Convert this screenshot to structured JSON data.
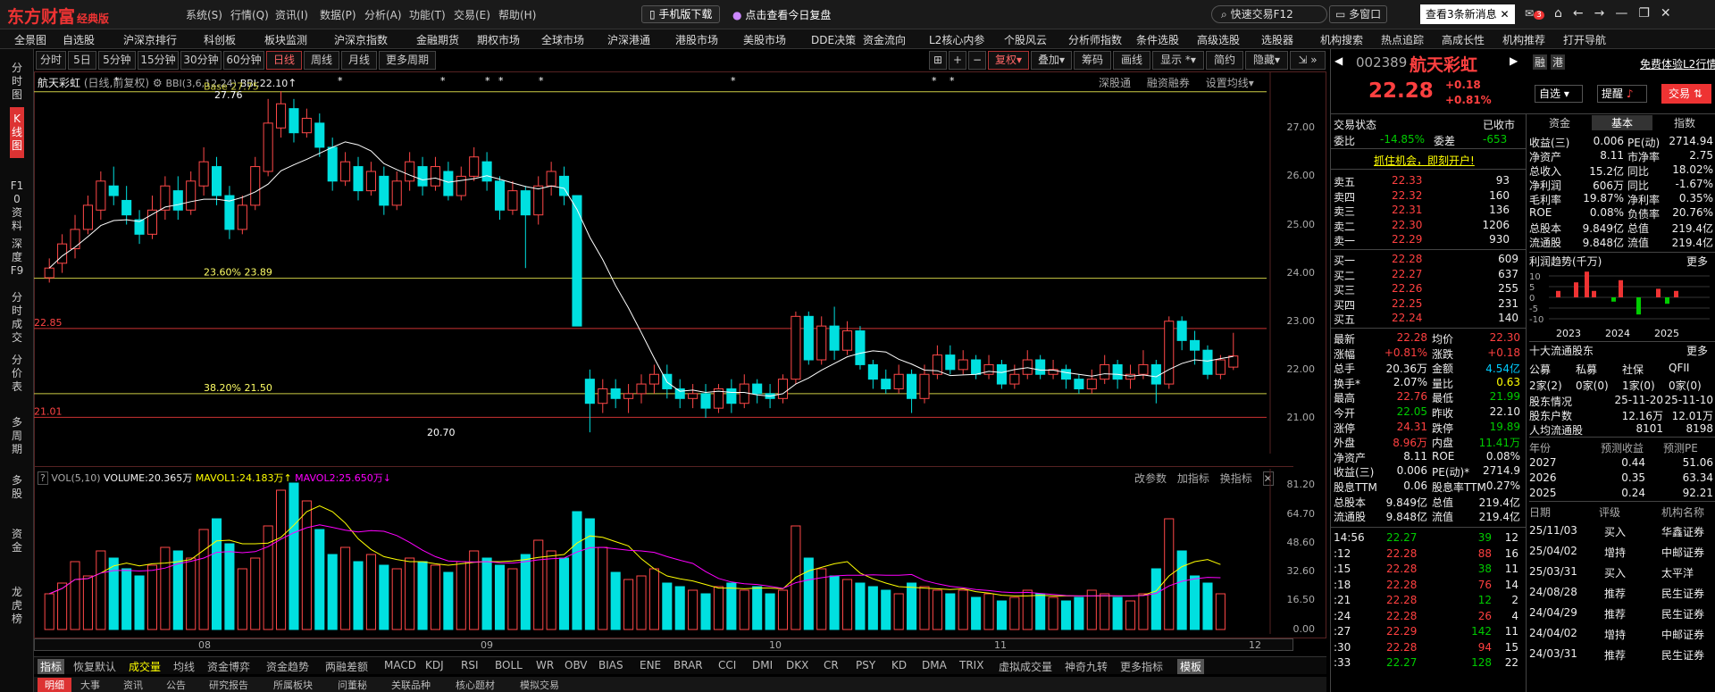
{
  "app": {
    "logo": "东方财富",
    "edition": "经典版",
    "menus": [
      "系统(S)",
      "行情(Q)",
      "资讯(I)",
      "数据(P)",
      "分析(A)",
      "功能(T)",
      "交易(E)",
      "帮助(H)"
    ],
    "mobile": "手机版下载",
    "review": "点击查看今日复盘",
    "quick_trade": "快速交易F12",
    "multi_window": "多窗口",
    "news": "查看3条新消息",
    "badge": "3"
  },
  "menubar": [
    "全景图",
    "自选股",
    "沪深京排行",
    "科创板",
    "板块监测",
    "沪深京指数",
    "金融期货",
    "期权市场",
    "全球市场",
    "沪深港通",
    "港股市场",
    "美股市场",
    "DDE决策",
    "资金流向",
    "L2核心内参",
    "个股风云",
    "分析师指数",
    "条件选股",
    "高级选股",
    "选股器",
    "机构搜索",
    "热点追踪",
    "高成长性",
    "机构推荐",
    "打开导航"
  ],
  "leftnav": [
    "分时图",
    "K线图",
    "F10资料",
    "深度F9",
    "分时成交",
    "分价表",
    "多周期",
    "多股",
    "资金",
    "龙虎榜"
  ],
  "periods": [
    "分时",
    "5日",
    "5分钟",
    "15分钟",
    "30分钟",
    "60分钟",
    "日线",
    "周线",
    "月线",
    "更多周期"
  ],
  "toolbar": [
    "复权",
    "叠加",
    "筹码",
    "画线",
    "显示",
    "简约",
    "隐藏"
  ],
  "kline": {
    "title": "航天彩虹",
    "subtitle": "(日线,前复权)",
    "bbi": "BBI(3,6,12,24)",
    "bbi_val": "BBI:22.10",
    "links": [
      "深股通",
      "融资融券",
      "设置均线"
    ],
    "y_labels": [
      "27.00",
      "26.00",
      "25.00",
      "24.00",
      "23.00",
      "22.00",
      "21.00"
    ],
    "fib": [
      "23.60% 23.89",
      "38.20% 21.50"
    ],
    "high_label": "27.76",
    "low_label": "20.70",
    "left_hi": "22.85",
    "left_lo": "21.01",
    "top_label": "Base 27.75"
  },
  "vol": {
    "title": "VOL(5,10)",
    "volume": "VOLUME:20.365万",
    "ma1": "MAVOL1:24.183万",
    "ma2": "MAVOL2:25.650万",
    "links": [
      "改参数",
      "加指标",
      "换指标"
    ],
    "y_labels": [
      "81.20",
      "64.70",
      "48.60",
      "32.60",
      "16.50",
      "0.00"
    ]
  },
  "x_axis": [
    "08",
    "09",
    "10",
    "11",
    "12"
  ],
  "indicators": [
    "指标",
    "恢复默认",
    "成交量",
    "均线",
    "资金博弈",
    "资金趋势",
    "两融差额",
    "MACD",
    "KDJ",
    "RSI",
    "BOLL",
    "WR",
    "OBV",
    "BIAS",
    "ENE",
    "BRAR",
    "CCI",
    "DMI",
    "DKX",
    "CR",
    "PSY",
    "KD",
    "DMA",
    "TRIX",
    "虚拟成交量",
    "神奇九转",
    "更多指标",
    "模板"
  ],
  "bottom_tabs": [
    "明细",
    "大事",
    "资讯",
    "公告",
    "研究报告",
    "所属板块",
    "问董秘",
    "关联品种",
    "核心题材",
    "模拟交易"
  ],
  "stock": {
    "code": "002389",
    "name": "航天彩虹",
    "price": "22.28",
    "chg": "+0.18",
    "pct": "+0.81%",
    "tags": [
      "融",
      "港"
    ],
    "l2": "免费体验L2行情",
    "select": "自选",
    "alert": "提醒",
    "trade": "交易"
  },
  "status": {
    "label": "交易状态",
    "value": "已收市",
    "wb_label": "委比",
    "wb": "-14.85%",
    "wc_label": "委差",
    "wc": "-653",
    "promo": "抓住机会，即刻开户!"
  },
  "sells": [
    [
      "卖五",
      "22.33",
      "93"
    ],
    [
      "卖四",
      "22.32",
      "160"
    ],
    [
      "卖三",
      "22.31",
      "136"
    ],
    [
      "卖二",
      "22.30",
      "1206"
    ],
    [
      "卖一",
      "22.29",
      "930"
    ]
  ],
  "buys": [
    [
      "买一",
      "22.28",
      "609"
    ],
    [
      "买二",
      "22.27",
      "637"
    ],
    [
      "买三",
      "22.26",
      "255"
    ],
    [
      "买四",
      "22.25",
      "231"
    ],
    [
      "买五",
      "22.24",
      "140"
    ]
  ],
  "quote": [
    [
      "最新",
      "22.28",
      "均价",
      "22.30"
    ],
    [
      "涨幅",
      "+0.81%",
      "涨跌",
      "+0.18"
    ],
    [
      "总手",
      "20.36万",
      "金额",
      "4.54亿"
    ],
    [
      "换手*",
      "2.07%",
      "量比",
      "0.63"
    ],
    [
      "最高",
      "22.76",
      "最低",
      "21.99"
    ],
    [
      "今开",
      "22.05",
      "昨收",
      "22.10"
    ],
    [
      "涨停",
      "24.31",
      "跌停",
      "19.89"
    ],
    [
      "外盘",
      "8.96万",
      "内盘",
      "11.41万"
    ],
    [
      "净资产",
      "8.11",
      "ROE",
      "0.08%"
    ],
    [
      "收益(三)",
      "0.006",
      "PE(动)*",
      "2714.9"
    ],
    [
      "股息TTM",
      "0.06",
      "股息率TTM",
      "0.27%"
    ],
    [
      "总股本",
      "9.849亿",
      "总值",
      "219.4亿"
    ],
    [
      "流通股",
      "9.848亿",
      "流值",
      "219.4亿"
    ]
  ],
  "ticks": [
    [
      "14:56",
      "22.27",
      "39",
      "12"
    ],
    [
      ":12",
      "22.28",
      "88",
      "16"
    ],
    [
      ":15",
      "22.28",
      "38",
      "11"
    ],
    [
      ":18",
      "22.28",
      "76",
      "14"
    ],
    [
      ":21",
      "22.28",
      "12",
      "2"
    ],
    [
      ":24",
      "22.28",
      "26",
      "4"
    ],
    [
      ":27",
      "22.29",
      "142",
      "11"
    ],
    [
      ":30",
      "22.28",
      "94",
      "15"
    ],
    [
      ":33",
      "22.27",
      "128",
      "22"
    ]
  ],
  "fin_tabs": [
    "资金",
    "基本",
    "指数"
  ],
  "fin": [
    [
      "收益(三)",
      "0.006",
      "PE(动)",
      "2714.94"
    ],
    [
      "净资产",
      "8.11",
      "市净率",
      "2.75"
    ],
    [
      "总收入",
      "15.2亿",
      "同比",
      "18.02%"
    ],
    [
      "净利润",
      "606万",
      "同比",
      "-1.67%"
    ],
    [
      "毛利率",
      "19.87%",
      "净利率",
      "0.35%"
    ],
    [
      "ROE",
      "0.08%",
      "负债率",
      "20.76%"
    ],
    [
      "总股本",
      "9.849亿",
      "总值",
      "219.4亿"
    ],
    [
      "流通股",
      "9.848亿",
      "流值",
      "219.4亿"
    ]
  ],
  "profit": {
    "title": "利润趋势(千万)",
    "more": "更多",
    "years": [
      "2023",
      "2024",
      "2025"
    ],
    "y": [
      "10",
      "5",
      "0",
      "-5",
      "-10"
    ]
  },
  "holders": {
    "title": "十大流通股东",
    "more": "更多",
    "cols": [
      "公募",
      "私募",
      "社保",
      "QFII"
    ],
    "vals": [
      "2家(2)",
      "0家(0)",
      "1家(0)",
      "0家(0)"
    ],
    "rows": [
      [
        "股东情况",
        "25-11-20",
        "25-11-10"
      ],
      [
        "股东户数",
        "12.16万",
        "12.01万"
      ],
      [
        "人均流通股",
        "8101",
        "8198"
      ]
    ]
  },
  "forecast": {
    "cols": [
      "年份",
      "预测收益",
      "预测PE"
    ],
    "rows": [
      [
        "2027",
        "0.44",
        "51.06"
      ],
      [
        "2026",
        "0.35",
        "63.34"
      ],
      [
        "2025",
        "0.24",
        "92.21"
      ]
    ]
  },
  "ratings": {
    "cols": [
      "日期",
      "评级",
      "机构名称"
    ],
    "rows": [
      [
        "25/11/03",
        "买入",
        "华鑫证券"
      ],
      [
        "25/04/02",
        "增持",
        "中邮证券"
      ],
      [
        "25/03/31",
        "买入",
        "太平洋"
      ],
      [
        "24/08/28",
        "推荐",
        "民生证券"
      ],
      [
        "24/04/29",
        "推荐",
        "民生证券"
      ],
      [
        "24/04/02",
        "增持",
        "中邮证券"
      ],
      [
        "24/03/31",
        "推荐",
        "民生证券"
      ]
    ]
  },
  "chart_data": {
    "type": "candlestick",
    "title": "航天彩虹",
    "ylim": [
      20.5,
      27.8
    ],
    "candles": [
      [
        23.9,
        24.1,
        23.8,
        24.3
      ],
      [
        24.2,
        24.6,
        24.0,
        24.8
      ],
      [
        24.5,
        24.9,
        24.3,
        25.2
      ],
      [
        24.9,
        25.4,
        24.8,
        25.6
      ],
      [
        25.3,
        25.9,
        25.1,
        26.1
      ],
      [
        25.8,
        25.6,
        25.4,
        26.2
      ],
      [
        25.5,
        25.2,
        25.0,
        25.8
      ],
      [
        25.1,
        24.8,
        24.6,
        25.3
      ],
      [
        24.8,
        25.3,
        24.7,
        25.6
      ],
      [
        25.3,
        25.8,
        25.1,
        26.0
      ],
      [
        25.7,
        25.3,
        25.1,
        26.0
      ],
      [
        25.3,
        25.9,
        25.2,
        26.1
      ],
      [
        25.8,
        26.3,
        25.6,
        26.6
      ],
      [
        26.2,
        25.6,
        25.4,
        26.4
      ],
      [
        25.6,
        24.9,
        24.7,
        25.8
      ],
      [
        24.9,
        25.4,
        24.8,
        25.6
      ],
      [
        25.4,
        26.2,
        25.3,
        26.4
      ],
      [
        26.1,
        27.1,
        26.0,
        27.6
      ],
      [
        27.0,
        27.5,
        26.8,
        27.76
      ],
      [
        27.4,
        26.9,
        26.7,
        27.6
      ],
      [
        26.9,
        27.2,
        26.8,
        27.4
      ],
      [
        27.1,
        26.6,
        26.4,
        27.3
      ],
      [
        26.6,
        25.9,
        25.7,
        26.8
      ],
      [
        25.9,
        26.3,
        25.8,
        26.5
      ],
      [
        26.2,
        25.7,
        25.5,
        26.4
      ],
      [
        25.7,
        26.1,
        25.6,
        26.3
      ],
      [
        26.0,
        25.4,
        25.2,
        26.2
      ],
      [
        25.4,
        25.9,
        25.3,
        26.1
      ],
      [
        25.9,
        26.3,
        25.7,
        26.5
      ],
      [
        26.2,
        25.8,
        25.6,
        26.4
      ],
      [
        25.8,
        26.2,
        25.7,
        26.4
      ],
      [
        26.1,
        25.6,
        25.5,
        26.3
      ],
      [
        25.6,
        26.0,
        25.5,
        26.2
      ],
      [
        26.0,
        26.4,
        25.9,
        26.6
      ],
      [
        26.3,
        25.9,
        25.7,
        26.5
      ],
      [
        25.9,
        25.3,
        25.1,
        26.0
      ],
      [
        25.3,
        25.7,
        25.2,
        25.9
      ],
      [
        25.7,
        25.2,
        24.1,
        25.8
      ],
      [
        25.2,
        25.8,
        25.0,
        26.0
      ],
      [
        25.8,
        26.1,
        25.6,
        26.3
      ],
      [
        26.0,
        25.6,
        25.4,
        26.2
      ],
      [
        25.6,
        22.9,
        22.9,
        25.6
      ],
      [
        21.8,
        21.3,
        20.7,
        22.0
      ],
      [
        21.3,
        21.6,
        21.1,
        21.8
      ],
      [
        21.6,
        21.4,
        21.2,
        21.8
      ],
      [
        21.4,
        21.5,
        21.1,
        21.7
      ],
      [
        21.5,
        21.7,
        21.3,
        21.9
      ],
      [
        21.7,
        21.9,
        21.5,
        22.1
      ],
      [
        21.9,
        21.6,
        21.4,
        22.1
      ],
      [
        21.6,
        21.4,
        21.2,
        21.8
      ],
      [
        21.4,
        21.5,
        21.2,
        21.7
      ],
      [
        21.5,
        21.2,
        21.0,
        21.7
      ],
      [
        21.2,
        21.6,
        21.1,
        21.7
      ],
      [
        21.6,
        21.3,
        21.1,
        21.8
      ],
      [
        21.3,
        21.7,
        21.2,
        21.9
      ],
      [
        21.7,
        21.5,
        21.3,
        21.8
      ],
      [
        21.5,
        21.4,
        21.2,
        21.7
      ],
      [
        21.4,
        21.8,
        21.3,
        21.9
      ],
      [
        21.8,
        23.1,
        21.7,
        23.2
      ],
      [
        23.1,
        22.2,
        22.1,
        23.2
      ],
      [
        22.2,
        22.9,
        22.1,
        23.1
      ],
      [
        22.9,
        22.4,
        22.2,
        23.3
      ],
      [
        22.4,
        22.8,
        22.3,
        23.0
      ],
      [
        22.8,
        22.1,
        22.0,
        22.9
      ],
      [
        22.1,
        21.8,
        21.6,
        22.2
      ],
      [
        21.8,
        21.6,
        21.5,
        22.0
      ],
      [
        21.6,
        21.9,
        21.5,
        22.1
      ],
      [
        21.9,
        21.4,
        21.1,
        22.0
      ],
      [
        21.4,
        21.9,
        21.3,
        22.1
      ],
      [
        21.9,
        22.3,
        21.8,
        22.5
      ],
      [
        22.3,
        22.0,
        21.9,
        22.5
      ],
      [
        22.0,
        22.2,
        21.9,
        22.4
      ],
      [
        22.2,
        21.9,
        21.8,
        22.3
      ],
      [
        21.9,
        22.1,
        21.8,
        22.3
      ],
      [
        22.1,
        21.7,
        21.6,
        22.2
      ],
      [
        21.7,
        21.9,
        21.6,
        22.1
      ],
      [
        21.9,
        22.2,
        21.8,
        22.4
      ],
      [
        22.2,
        21.9,
        21.8,
        22.3
      ],
      [
        21.9,
        22.0,
        21.8,
        22.2
      ],
      [
        22.0,
        21.8,
        21.6,
        22.1
      ],
      [
        21.8,
        21.6,
        21.5,
        21.9
      ],
      [
        21.6,
        21.8,
        21.5,
        22.0
      ],
      [
        21.8,
        22.1,
        21.7,
        22.3
      ],
      [
        22.1,
        21.8,
        21.6,
        22.2
      ],
      [
        21.8,
        21.9,
        21.6,
        22.1
      ],
      [
        21.9,
        22.1,
        21.8,
        22.4
      ],
      [
        22.1,
        21.7,
        21.3,
        22.2
      ],
      [
        21.7,
        23.0,
        21.6,
        23.1
      ],
      [
        23.0,
        22.6,
        22.4,
        23.1
      ],
      [
        22.6,
        22.4,
        22.1,
        22.8
      ],
      [
        22.4,
        21.9,
        21.8,
        22.5
      ],
      [
        21.9,
        22.2,
        21.8,
        22.3
      ],
      [
        22.05,
        22.28,
        21.99,
        22.76
      ]
    ],
    "volume": [
      20,
      26,
      38,
      30,
      44,
      40,
      34,
      30,
      36,
      46,
      44,
      40,
      56,
      62,
      48,
      34,
      40,
      58,
      78,
      82,
      72,
      56,
      42,
      46,
      38,
      42,
      36,
      34,
      40,
      38,
      36,
      32,
      38,
      44,
      40,
      36,
      34,
      42,
      50,
      44,
      40,
      66,
      62,
      46,
      32,
      28,
      30,
      34,
      26,
      24,
      22,
      20,
      24,
      26,
      22,
      24,
      20,
      22,
      58,
      40,
      34,
      30,
      28,
      26,
      24,
      22,
      20,
      26,
      24,
      22,
      20,
      22,
      18,
      20,
      16,
      18,
      22,
      20,
      18,
      16,
      18,
      22,
      20,
      18,
      16,
      20,
      34,
      62,
      44,
      30,
      26,
      20
    ]
  }
}
